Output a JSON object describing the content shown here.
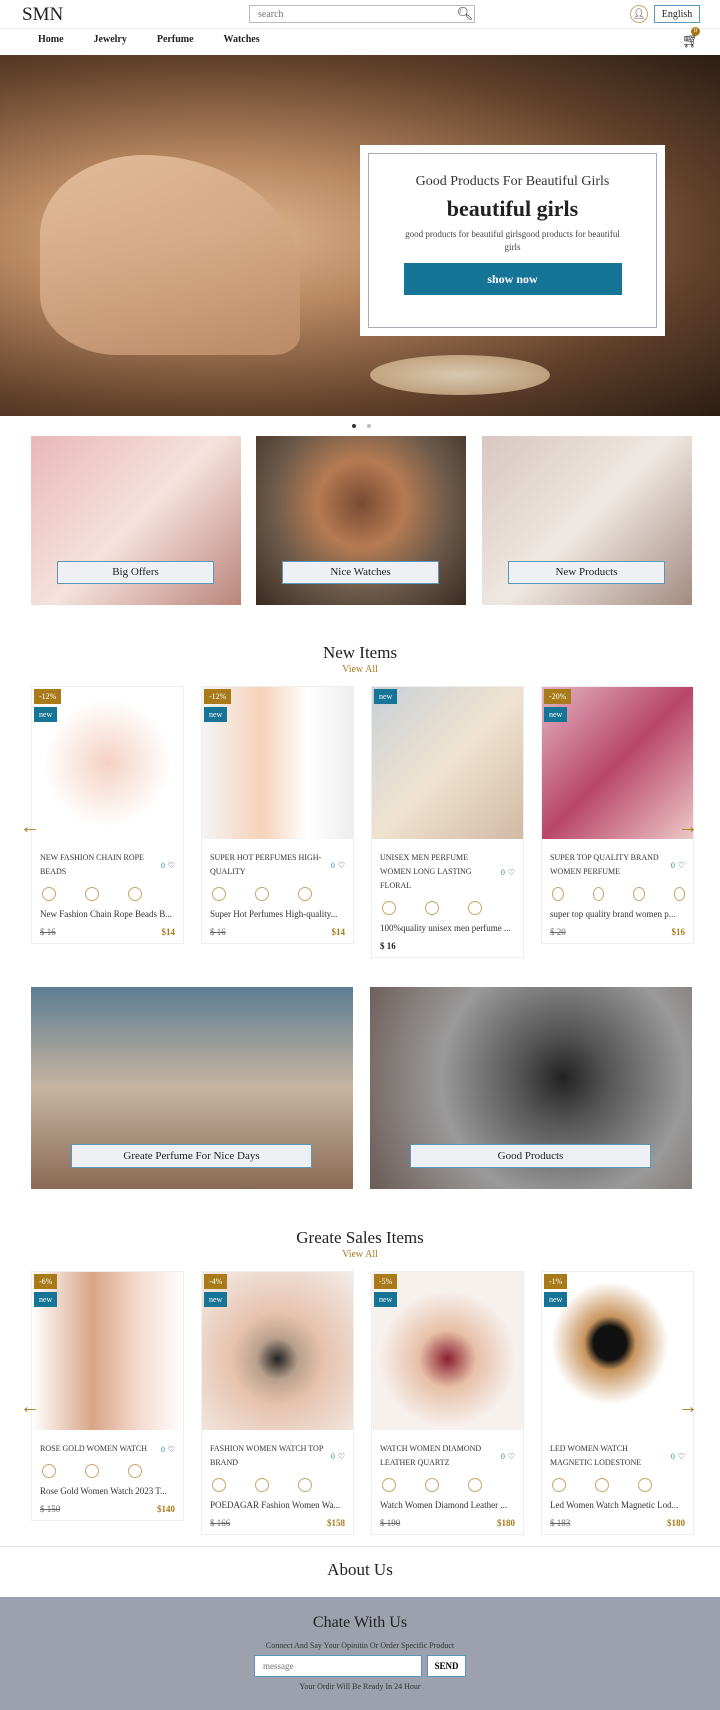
{
  "header": {
    "logo": "SMN",
    "search_placeholder": "search",
    "language": "English",
    "cart_count": "0"
  },
  "nav": [
    "Home",
    "Jewelry",
    "Perfume",
    "Watches"
  ],
  "hero": {
    "subtitle": "Good Products For Beautiful Girls",
    "title": "beautiful girls",
    "text": "good products for beautiful girlsgood products for beautiful girls",
    "button": "show now",
    "slides": 2,
    "active_slide": 1
  },
  "categories": [
    {
      "label": "Big Offers",
      "bg": "linear-gradient(135deg,#e8b8b8,#f6e2dd 50%,#b9857a)"
    },
    {
      "label": "Nice Watches",
      "bg": "radial-gradient(circle at 50% 40%,#7a4a32 0,#b57b52 30%,#6d5a4a 60%,#3a2a20)"
    },
    {
      "label": "New Products",
      "bg": "linear-gradient(135deg,#d8c7c0,#efe8e2 50%,#a48b80)"
    }
  ],
  "new_items": {
    "title": "New Items",
    "view_all": "View All",
    "products": [
      {
        "discount": "-12%",
        "badge": "new",
        "title": "NEW FASHION CHAIN ROPE BEADS",
        "likes": "0",
        "desc": "New Fashion Chain Rope Beads B...",
        "old_price": "$ 16",
        "price": "$14",
        "swatches": 3,
        "bg": "radial-gradient(circle,#f4d2c3 0,#fff 60%)"
      },
      {
        "discount": "-12%",
        "badge": "new",
        "title": "SUPER HOT PERFUMES HIGH-QUALITY",
        "likes": "0",
        "desc": "Super Hot Perfumes High-quality...",
        "old_price": "$ 16",
        "price": "$14",
        "swatches": 3,
        "bg": "linear-gradient(90deg,#f4f4f4,#f6d2b8 40%,#fff 70%,#eee)"
      },
      {
        "discount": "",
        "badge": "new",
        "title": "UNISEX MEN PERFUME WOMEN LONG LASTING FLORAL",
        "likes": "0",
        "desc": "100%quality unisex men perfume ...",
        "old_price": "",
        "price": "$ 16",
        "swatches": 3,
        "bg": "linear-gradient(135deg,#c9d0d8,#efe3cf 50%,#d2b9a4)"
      },
      {
        "discount": "-20%",
        "badge": "new",
        "title": "SUPER TOP QUALITY BRAND WOMEN PERFUME",
        "likes": "0",
        "desc": "super top quality brand women p...",
        "old_price": "$ 20",
        "price": "$16",
        "swatches": 4,
        "bg": "linear-gradient(135deg,#e3b4c0,#b8466b 50%,#eec8c8)"
      }
    ]
  },
  "banners": [
    {
      "label": "Greate Perfume For Nice Days",
      "bg": "linear-gradient(180deg,#5d7d93,#c7b5a0 50%,#8a6a55)"
    },
    {
      "label": "Good Products",
      "bg": "radial-gradient(circle at 60% 45%,#222 0,#555 20%,#9a9a9a 55%,#6a5a55)"
    }
  ],
  "sales_items": {
    "title": "Greate Sales Items",
    "view_all": "View All",
    "products": [
      {
        "discount": "-6%",
        "badge": "new",
        "title": "ROSE GOLD WOMEN WATCH",
        "likes": "0",
        "desc": "Rose Gold Women Watch 2023 T...",
        "old_price": "$ 150",
        "price": "$140",
        "swatches": 3,
        "bg": "linear-gradient(90deg,#fff,#d9a586 40%,#f3d9ce 70%,#fff)"
      },
      {
        "discount": "-4%",
        "badge": "new",
        "title": "FASHION WOMEN WATCH TOP BRAND",
        "likes": "0",
        "desc": "POEDAGAR Fashion Women Wa...",
        "old_price": "$ 166",
        "price": "$158",
        "swatches": 3,
        "bg": "radial-gradient(circle at 50% 55%,#222 0,#b9a08c 18%,#e6c3ae 40%,#f4ece8)"
      },
      {
        "discount": "-5%",
        "badge": "new",
        "title": "WATCH WOMEN DIAMOND LEATHER QUARTZ",
        "likes": "0",
        "desc": "Watch Women Diamond Leather ...",
        "old_price": "$ 190",
        "price": "$180",
        "swatches": 3,
        "bg": "radial-gradient(circle at 50% 55%,#8a2030 0,#e7c0a8 25%,#f7f1ee 60%)"
      },
      {
        "discount": "-1%",
        "badge": "new",
        "title": "LED WOMEN WATCH MAGNETIC LODESTONE",
        "likes": "0",
        "desc": "Led Women Watch Magnetic Lod...",
        "old_price": "$ 183",
        "price": "$180",
        "swatches": 3,
        "bg": "radial-gradient(ellipse at 45% 45%,#111 0,#111 14%,#c9955e 22%,#fff 50%)"
      }
    ]
  },
  "about": {
    "title": "About Us"
  },
  "footer": {
    "title": "Chate With Us",
    "subtitle": "Connect And Say Your Opinitin Or Order Specific Product",
    "placeholder": "message",
    "send": "SEND",
    "note": "Your Ordir Will Be Ready In 24 Hour"
  },
  "colors": {
    "accent": "#a87a1a",
    "primary": "#167497",
    "footer_bg": "#9ca1ad"
  }
}
